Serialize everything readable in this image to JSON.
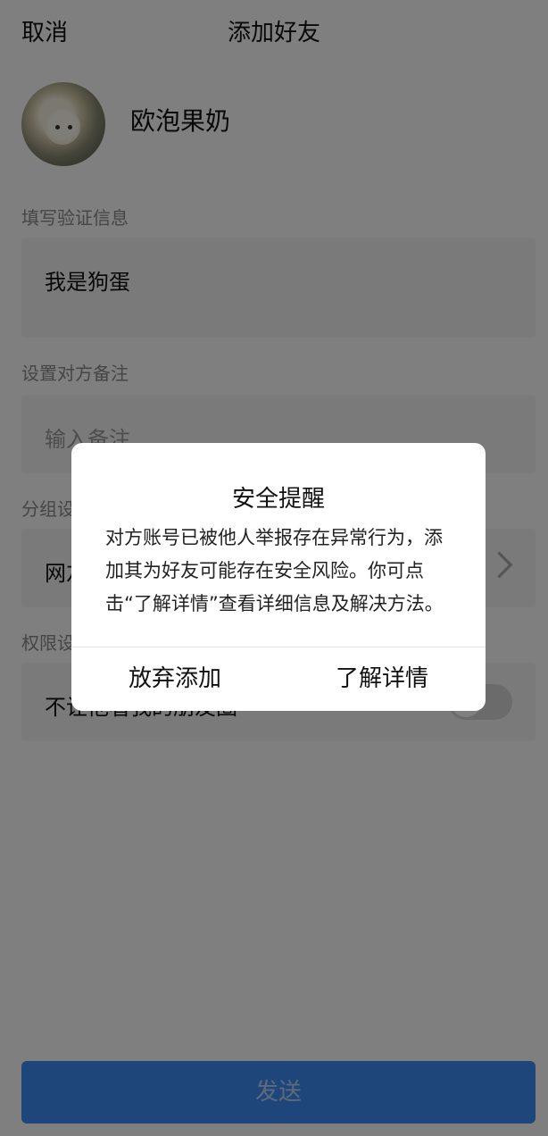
{
  "header": {
    "cancel_label": "取消",
    "title": "添加好友"
  },
  "profile": {
    "nickname": "欧泡果奶"
  },
  "verify": {
    "label": "填写验证信息",
    "value": "我是狗蛋"
  },
  "remark": {
    "label": "设置对方备注",
    "placeholder": "输入备注"
  },
  "group": {
    "label": "分组设置",
    "value": "网友"
  },
  "permission": {
    "label": "权限设置",
    "item_label": "不让他看我的朋友圈",
    "enabled": false
  },
  "send": {
    "label": "发送"
  },
  "dialog": {
    "title": "安全提醒",
    "message": "对方账号已被他人举报存在异常行为，添加其为好友可能存在安全风险。你可点击“了解详情”查看详细信息及解决方法。",
    "cancel_label": "放弃添加",
    "confirm_label": "了解详情"
  },
  "colors": {
    "accent": "#3c8cf7",
    "overlay": "rgba(0,0,0,0.5)"
  }
}
